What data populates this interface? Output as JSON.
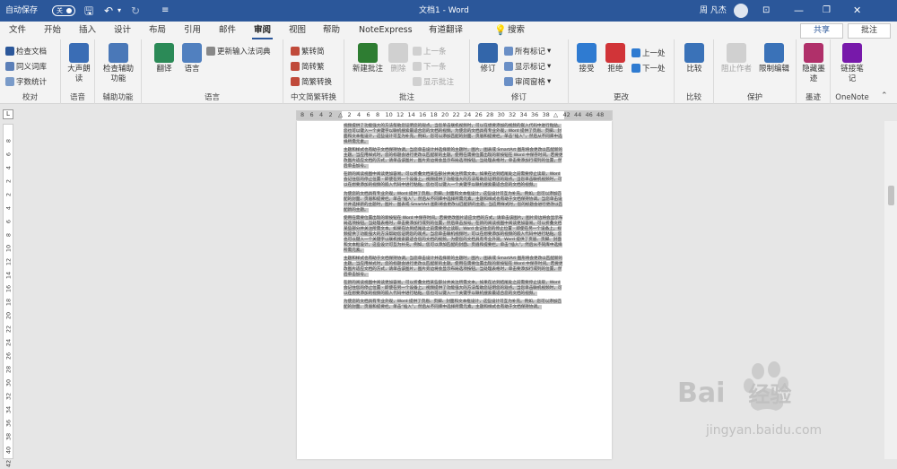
{
  "titlebar": {
    "autosave_label": "自动保存",
    "autosave_state": "关",
    "title": "文档1 - Word",
    "user": "周 凡杰"
  },
  "tabs": [
    "文件",
    "开始",
    "插入",
    "设计",
    "布局",
    "引用",
    "邮件",
    "审阅",
    "视图",
    "帮助",
    "NoteExpress",
    "有道翻译"
  ],
  "active_tab": "审阅",
  "search": {
    "label": "搜索"
  },
  "share": "共享",
  "comments": "批注",
  "ribbon": {
    "proofing": {
      "label": "校对",
      "items": [
        "检查文档",
        "同义词库",
        "字数统计"
      ]
    },
    "speech": {
      "label": "语音",
      "read_aloud": "大声朗读"
    },
    "accessibility": {
      "label": "辅助功能",
      "check": "检查辅助功能"
    },
    "language": {
      "label": "语言",
      "translate": "翻译",
      "language": "语言",
      "update_ime": "更新输入法词典"
    },
    "chinese": {
      "label": "中文简繁转换",
      "items": [
        "繁转简",
        "简转繁",
        "简繁转换"
      ]
    },
    "comments_grp": {
      "label": "批注",
      "new": "新建批注",
      "delete": "删除",
      "prev": "上一条",
      "next": "下一条",
      "show": "显示批注"
    },
    "tracking": {
      "label": "修订",
      "track": "修订",
      "markup_select": "所有标记",
      "show_markup": "显示标记",
      "pane": "审阅窗格"
    },
    "changes": {
      "label": "更改",
      "accept": "接受",
      "reject": "拒绝",
      "prev": "上一处",
      "next": "下一处"
    },
    "compare": {
      "label": "比较",
      "compare": "比较"
    },
    "protect": {
      "label": "保护",
      "block_authors": "阻止作者",
      "restrict": "限制编辑"
    },
    "ink": {
      "label": "墨迹",
      "hide_ink": "隐藏墨迹"
    },
    "onenote": {
      "label": "OneNote",
      "linked_notes": "链接笔记"
    }
  },
  "ruler": {
    "left": [
      "8",
      "6",
      "4",
      "2"
    ],
    "right": [
      "2",
      "4",
      "6",
      "8",
      "10",
      "12",
      "14",
      "16",
      "18",
      "20",
      "22",
      "24",
      "26",
      "28",
      "30",
      "32",
      "34",
      "36",
      "38"
    ],
    "end": [
      "42",
      "44",
      "46",
      "48"
    ],
    "vertical": [
      "8",
      "6",
      "4",
      "2",
      "2",
      "4",
      "6",
      "8",
      "10",
      "12",
      "14",
      "16",
      "18",
      "20",
      "22",
      "24",
      "26",
      "28",
      "30",
      "32",
      "34",
      "36",
      "38",
      "40",
      "42"
    ]
  },
  "document": {
    "paragraphs": [
      "视频提供了功能强大的方法帮助您证明您的观点。当您单击联机视频时，可以在想要添加的视频的嵌入代码中进行粘贴。您也可以键入一个关键字以联机搜索最适合您的文档的视频。为使您的文档具有专业外观，Word 提供了页眉、页脚、封面和文本框设计，这些设计可互为补充。例如，您可以添加匹配的封面、页眉和提要栏。单击“插入”，然后从不同库中选择所需元素。",
      "主题和样式也有助于文档保持协调。当您单击设计并选择新的主题时，图片、图表或 SmartArt 图形将会更改以匹配新的主题。当应用样式时，您的标题会进行更改以匹配新的主题。使用在需要位置出现的新按钮在 Word 中保存时间。若要更改图片适应文档的方式，请单击该图片，图片旁边将会显示布局选项按钮。当处理表格时，单击要添加行或列的位置，然后单击加号。",
      "在新的阅读视图中阅读更加容易。可以折叠文档某些部分并关注所需文本。如果在达到结尾处之前需要停止读取，Word 会记住您的停止位置 - 即使在另一个设备上。视频提供了功能强大的方法帮助您证明您的观点。当您单击联机视频时，可以在想要添加的视频的嵌入代码中进行粘贴。您也可以键入一个关键字以联机搜索最适合您的文档的视频。",
      "为使您的文档具有专业外观，Word 提供了页眉、页脚、封面和文本框设计，这些设计可互为补充。例如，您可以添加匹配的封面、页眉和提要栏。单击“插入”，然后从不同库中选择所需元素。主题和样式也有助于文档保持协调。当您单击设计并选择新的主题时，图片、图表或 SmartArt 图形将会更改以匹配新的主题。当应用样式时，您的标题会进行更改以匹配新的主题。",
      "使用在需要位置出现的新按钮在 Word 中保存时间。若要更改图片适应文档的方式，请单击该图片，图片旁边将会显示布局选项按钮。当处理表格时，单击要添加行或列的位置，然后单击加号。在新的阅读视图中阅读更加容易。可以折叠文档某些部分并关注所需文本。如果在达到结尾处之前需要停止读取，Word 会记住您的停止位置 - 即使在另一个设备上。视频提供了功能强大的方法帮助您证明您的观点。当您单击联机视频时，可以在想要添加的视频的嵌入代码中进行粘贴。您也可以键入一个关键字以联机搜索最适合您的文档的视频。为使您的文档具有专业外观，Word 提供了页眉、页脚、封面和文本框设计，这些设计可互为补充。例如，您可以添加匹配的封面、页眉和提要栏。单击“插入”，然后从不同库中选择所需元素。",
      "主题和样式也有助于文档保持协调。当您单击设计并选择新的主题时，图片、图表或 SmartArt 图形将会更改以匹配新的主题。当应用样式时，您的标题会进行更改以匹配新的主题。使用在需要位置出现的新按钮在 Word 中保存时间。若要更改图片适应文档的方式，请单击该图片，图片旁边将会显示布局选项按钮。当处理表格时，单击要添加行或列的位置，然后单击加号。",
      "在新的阅读视图中阅读更加容易。可以折叠文档某些部分并关注所需文本。如果在达到结尾处之前需要停止读取，Word 会记住您的停止位置 - 即使在另一个设备上。视频提供了功能强大的方法帮助您证明您的观点。当您单击联机视频时，可以在想要添加的视频的嵌入代码中进行粘贴。您也可以键入一个关键字以联机搜索最适合您的文档的视频。",
      "为使您的文档具有专业外观，Word 提供了页眉、页脚、封面和文本框设计，这些设计可互为补充。例如，您可以添加匹配的封面、页眉和提要栏。单击“插入”，然后从不同库中选择所需元素。主题和样式也有助于文档保持协调。"
    ]
  },
  "watermark": {
    "brand_cn": "经验",
    "brand_en": "Bai",
    "url": "jingyan.baidu.com"
  }
}
